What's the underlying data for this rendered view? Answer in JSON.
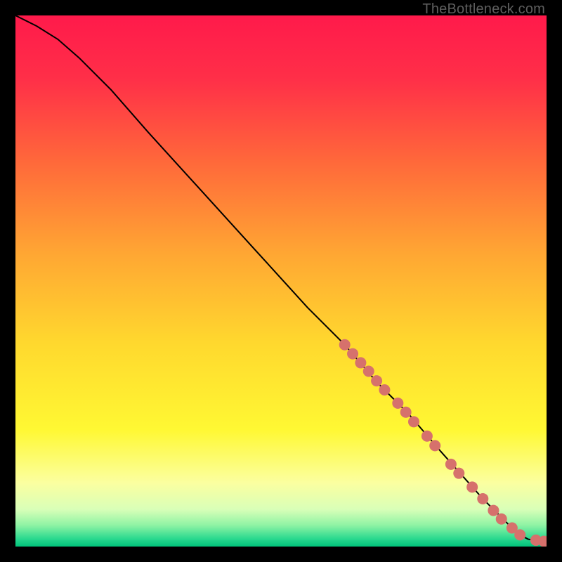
{
  "watermark": "TheBottleneck.com",
  "chart_data": {
    "type": "line",
    "title": "",
    "xlabel": "",
    "ylabel": "",
    "xlim": [
      0,
      100
    ],
    "ylim": [
      0,
      100
    ],
    "background_gradient": {
      "stops": [
        {
          "offset": 0.0,
          "color": "#ff1a4b"
        },
        {
          "offset": 0.12,
          "color": "#ff2f48"
        },
        {
          "offset": 0.28,
          "color": "#ff6a3a"
        },
        {
          "offset": 0.45,
          "color": "#ffa733"
        },
        {
          "offset": 0.62,
          "color": "#ffd92e"
        },
        {
          "offset": 0.78,
          "color": "#fff833"
        },
        {
          "offset": 0.88,
          "color": "#fbffa0"
        },
        {
          "offset": 0.93,
          "color": "#d9ffb8"
        },
        {
          "offset": 0.96,
          "color": "#8ef3a4"
        },
        {
          "offset": 0.985,
          "color": "#2bd98f"
        },
        {
          "offset": 1.0,
          "color": "#00c27a"
        }
      ]
    },
    "series": [
      {
        "name": "curve",
        "x": [
          0,
          4,
          8,
          12,
          18,
          25,
          35,
          45,
          55,
          62,
          68,
          74,
          80,
          84,
          88,
          90,
          92,
          93.5,
          95,
          96.5,
          98,
          100
        ],
        "y": [
          100,
          98,
          95.5,
          92,
          86,
          78,
          67,
          56,
          45,
          38,
          31,
          25,
          18,
          13.5,
          9,
          7,
          5,
          3.5,
          2.2,
          1.4,
          1.1,
          1.0
        ]
      }
    ],
    "scatter": {
      "name": "markers",
      "color": "#d6716c",
      "radius": 8,
      "points": [
        {
          "x": 62.0,
          "y": 38.0
        },
        {
          "x": 63.5,
          "y": 36.3
        },
        {
          "x": 65.0,
          "y": 34.6
        },
        {
          "x": 66.5,
          "y": 33.0
        },
        {
          "x": 68.0,
          "y": 31.2
        },
        {
          "x": 69.5,
          "y": 29.5
        },
        {
          "x": 72.0,
          "y": 27.0
        },
        {
          "x": 73.5,
          "y": 25.3
        },
        {
          "x": 75.0,
          "y": 23.5
        },
        {
          "x": 77.5,
          "y": 20.8
        },
        {
          "x": 79.0,
          "y": 19.0
        },
        {
          "x": 82.0,
          "y": 15.5
        },
        {
          "x": 83.5,
          "y": 13.8
        },
        {
          "x": 86.0,
          "y": 11.2
        },
        {
          "x": 88.0,
          "y": 9.0
        },
        {
          "x": 90.0,
          "y": 6.8
        },
        {
          "x": 91.5,
          "y": 5.2
        },
        {
          "x": 93.5,
          "y": 3.5
        },
        {
          "x": 95.0,
          "y": 2.2
        },
        {
          "x": 98.0,
          "y": 1.2
        },
        {
          "x": 99.5,
          "y": 1.0
        }
      ]
    }
  }
}
